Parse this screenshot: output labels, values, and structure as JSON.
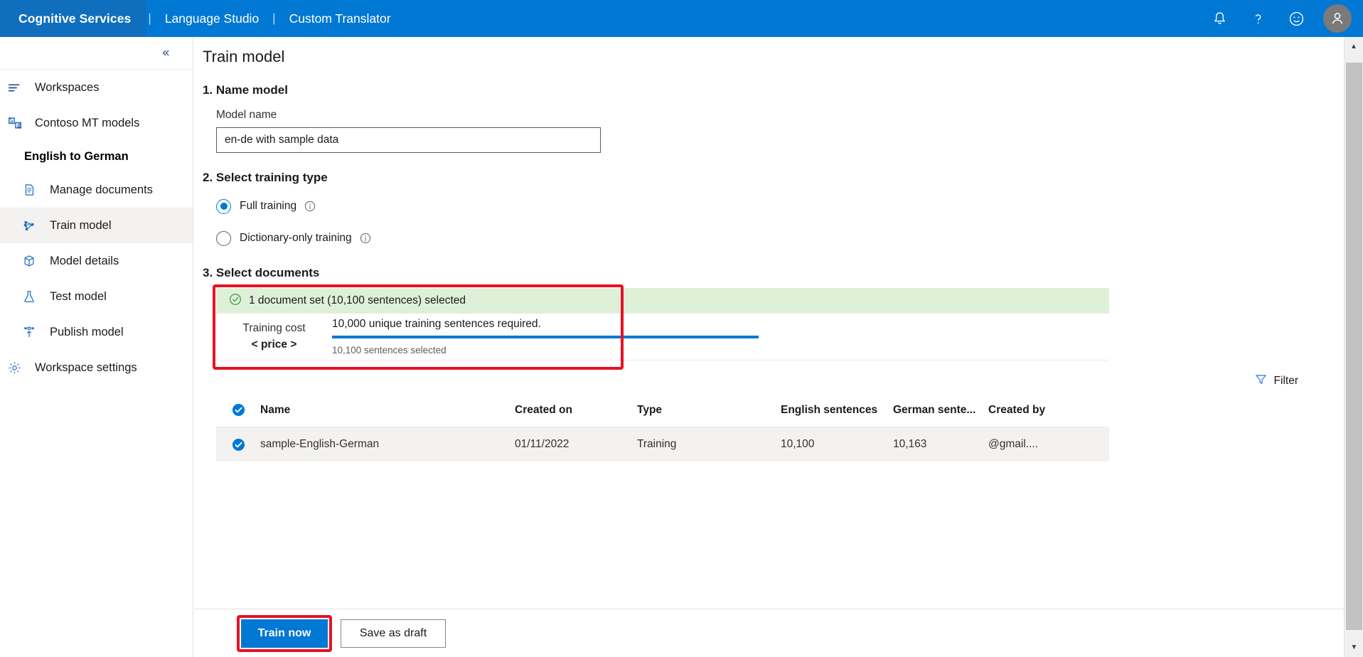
{
  "topbar": {
    "brand": "Cognitive Services",
    "separator": "|",
    "links": [
      {
        "label": "Language Studio"
      },
      {
        "label": "Custom Translator"
      }
    ],
    "icons": [
      {
        "name": "bell-icon",
        "title": "Notifications"
      },
      {
        "name": "question-icon",
        "title": "Help"
      },
      {
        "name": "smiley-icon",
        "title": "Feedback"
      }
    ],
    "avatar_name": "user-avatar",
    "background": "#0078d4",
    "brand_background": "#106ebe"
  },
  "sidebar": {
    "collapse_glyph": "«",
    "items": [
      {
        "label": "Workspaces",
        "icon": "list-icon",
        "level": "top",
        "selected": false
      },
      {
        "label": "Contoso MT models",
        "icon": "translator-icon",
        "level": "top",
        "selected": false
      },
      {
        "label": "English to German",
        "icon": "none",
        "level": "title",
        "selected": false
      },
      {
        "label": "Manage documents",
        "icon": "documents-icon",
        "level": "sub",
        "selected": false
      },
      {
        "label": "Train model",
        "icon": "train-model-icon",
        "level": "sub",
        "selected": true
      },
      {
        "label": "Model details",
        "icon": "box-icon",
        "level": "sub",
        "selected": false
      },
      {
        "label": "Test model",
        "icon": "flask-icon",
        "level": "sub",
        "selected": false
      },
      {
        "label": "Publish model",
        "icon": "publish-icon",
        "level": "sub",
        "selected": false
      },
      {
        "label": "Workspace settings",
        "icon": "gear-icon",
        "level": "top",
        "selected": false
      }
    ]
  },
  "main": {
    "page_title": "Train model",
    "step1": {
      "heading": "1. Name model",
      "field_label": "Model name",
      "model_name_value": "en-de with sample data",
      "model_name_placeholder": "Model name"
    },
    "step2": {
      "heading": "2. Select training type",
      "options": [
        {
          "label": "Full training",
          "selected": true,
          "info": "i"
        },
        {
          "label": "Dictionary-only training",
          "selected": false,
          "info": "i"
        }
      ]
    },
    "step3": {
      "heading": "3. Select documents",
      "banner_text": "1 document set (10,100 sentences) selected",
      "banner_icon": "check-circle-icon",
      "banner_background": "#dff0d8",
      "cost_label": "Training cost",
      "cost_value": "< price >",
      "requirement_text": "10,000 unique training sentences required.",
      "selected_text": "10,100 sentences selected",
      "progress_percent": 100,
      "progress_color": "#0078d4",
      "filter_label": "Filter",
      "filter_icon": "funnel-icon"
    },
    "table": {
      "columns": [
        "Name",
        "Created on",
        "Type",
        "English sentences",
        "German sente...",
        "Created by"
      ],
      "header_checkbox_checked": true,
      "rows": [
        {
          "checked": true,
          "name": "sample-English-German",
          "created_on": "01/11/2022",
          "type": "Training",
          "english_sentences": "10,100",
          "german_sentences": "10,163",
          "created_by": "@gmail...."
        }
      ]
    },
    "footer": {
      "primary_label": "Train now",
      "secondary_label": "Save as draft"
    },
    "highlight_color": "#e81123"
  },
  "scrollbar": {
    "up_glyph": "▲",
    "down_glyph": "▼"
  }
}
